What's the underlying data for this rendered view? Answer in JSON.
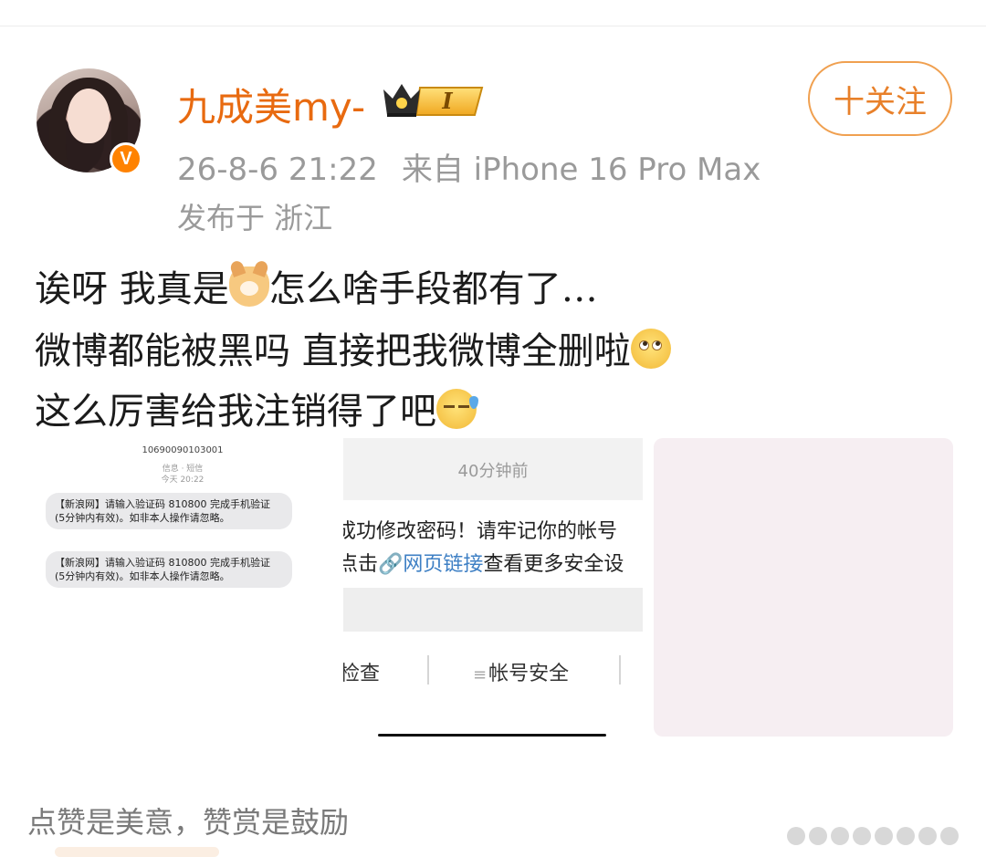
{
  "post": {
    "author": {
      "name": "九成美my-",
      "member_level": "I",
      "verified_mark": "V",
      "avatar_icon": "avatar-photo"
    },
    "meta": {
      "datetime": "26-8-6 21:22",
      "source": "来自 iPhone 16 Pro Max",
      "location": "发布于 浙江"
    },
    "follow_label": "十关注",
    "content": {
      "line1_a": "诶呀 我真是",
      "line1_b": "怎么啥手段都有了…",
      "line2": "微博都能被黑吗 直接把我微博全删啦",
      "line3": "这么厉害给我注销得了吧"
    },
    "images": {
      "image1": {
        "sender": "10690090103001",
        "date_line1": "信息 · 短信",
        "date_line2": "今天 20:22",
        "messages": [
          "【新浪网】请输入验证码 810800 完成手机验证 (5分钟内有效)。如非本人操作请忽略。",
          "【新浪网】请输入验证码 810800 完成手机验证 (5分钟内有效)。如非本人操作请忽略。"
        ]
      },
      "image2": {
        "time": "40分钟前",
        "text_line1": "成功修改密码！请牢记你的帐号",
        "text_line2_a": "点击",
        "text_line2_link": "🔗网页链接",
        "text_line2_b": "查看更多安全设",
        "bottom_left": "检查",
        "bottom_mid": "帐号安全",
        "bottom_mid_icon": "≡"
      }
    },
    "footer": {
      "reward_text": "点赞是美意，赞赏是鼓励"
    }
  },
  "colors": {
    "brand_orange": "#e86a10",
    "follow_border": "#f0a050",
    "meta_grey": "#9a9a9a",
    "link_blue": "#3d7fc4",
    "verified_orange": "#ff8200"
  }
}
